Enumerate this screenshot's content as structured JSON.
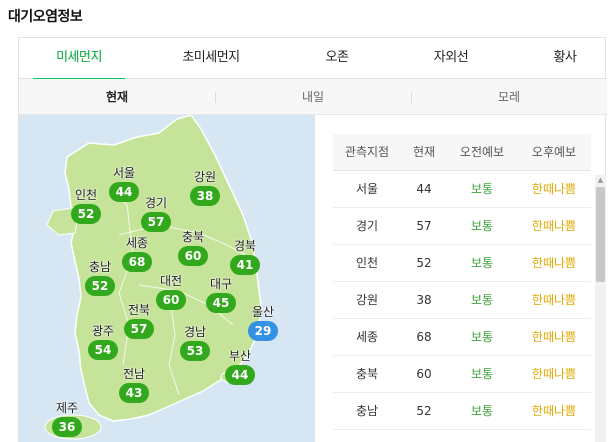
{
  "page_title": "대기오염정보",
  "main_tabs": [
    {
      "label": "미세먼지",
      "active": true
    },
    {
      "label": "초미세먼지",
      "active": false
    },
    {
      "label": "오존",
      "active": false
    },
    {
      "label": "자외선",
      "active": false
    },
    {
      "label": "황사",
      "active": false
    }
  ],
  "sub_tabs": [
    {
      "label": "현재",
      "active": true
    },
    {
      "label": "내일",
      "active": false
    },
    {
      "label": "모레",
      "active": false
    }
  ],
  "map": {
    "regions": [
      {
        "name": "서울",
        "value": "44",
        "color": "green"
      },
      {
        "name": "강원",
        "value": "38",
        "color": "green"
      },
      {
        "name": "인천",
        "value": "52",
        "color": "green"
      },
      {
        "name": "경기",
        "value": "57",
        "color": "green"
      },
      {
        "name": "세종",
        "value": "68",
        "color": "green"
      },
      {
        "name": "충북",
        "value": "60",
        "color": "green"
      },
      {
        "name": "경북",
        "value": "41",
        "color": "green"
      },
      {
        "name": "충남",
        "value": "52",
        "color": "green"
      },
      {
        "name": "대전",
        "value": "60",
        "color": "green"
      },
      {
        "name": "대구",
        "value": "45",
        "color": "green"
      },
      {
        "name": "전북",
        "value": "57",
        "color": "green"
      },
      {
        "name": "울산",
        "value": "29",
        "color": "blue"
      },
      {
        "name": "광주",
        "value": "54",
        "color": "green"
      },
      {
        "name": "경남",
        "value": "53",
        "color": "green"
      },
      {
        "name": "부산",
        "value": "44",
        "color": "green"
      },
      {
        "name": "전남",
        "value": "43",
        "color": "green"
      },
      {
        "name": "제주",
        "value": "36",
        "color": "green"
      }
    ],
    "colors": {
      "green_badge": "#32a91d",
      "blue_badge": "#3392e3",
      "land": "#c6e39a",
      "sea": "#d6e7f3"
    }
  },
  "table": {
    "headers": [
      "관측지점",
      "현재",
      "오전예보",
      "오후예보"
    ],
    "rows": [
      [
        "서울",
        "44",
        "보통",
        "한때나쁨"
      ],
      [
        "경기",
        "57",
        "보통",
        "한때나쁨"
      ],
      [
        "인천",
        "52",
        "보통",
        "한때나쁨"
      ],
      [
        "강원",
        "38",
        "보통",
        "한때나쁨"
      ],
      [
        "세종",
        "68",
        "보통",
        "한때나쁨"
      ],
      [
        "충북",
        "60",
        "보통",
        "한때나쁨"
      ],
      [
        "충남",
        "52",
        "보통",
        "한때나쁨"
      ]
    ]
  }
}
